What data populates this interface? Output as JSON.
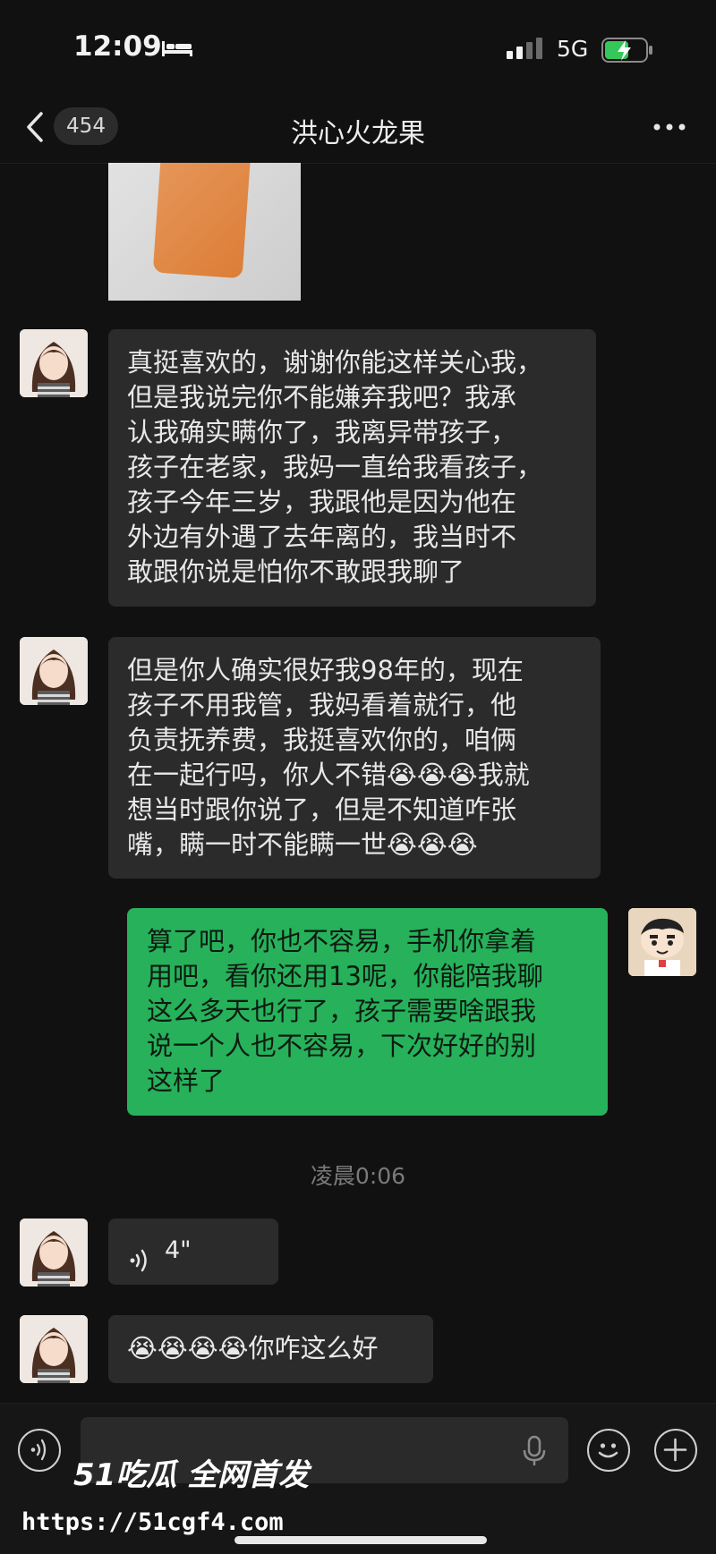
{
  "status_bar": {
    "time": "12:09",
    "network": "5G"
  },
  "header": {
    "unread_count": "454",
    "title": "洪心火龙果"
  },
  "messages": {
    "m1": "真挺喜欢的，谢谢你能这样关心我，\n但是我说完你不能嫌弃我吧？我承\n认我确实瞒你了，我离异带孩子，\n孩子在老家，我妈一直给我看孩子，\n孩子今年三岁，我跟他是因为他在\n外边有外遇了去年离的，我当时不\n敢跟你说是怕你不敢跟我聊了",
    "m2": "但是你人确实很好我98年的，现在\n孩子不用我管，我妈看着就行，他\n负责抚养费，我挺喜欢你的，咱俩\n在一起行吗，你人不错😭😭😭我就\n想当时跟你说了，但是不知道咋张\n嘴，瞒一时不能瞒一世😭😭😭",
    "m3": "算了吧，你也不容易，手机你拿着\n用吧，看你还用13呢，你能陪我聊\n这么多天也行了，孩子需要啥跟我\n说一个人也不容易，下次好好的别\n这样了",
    "timestamp": "凌晨0:06",
    "voice_duration": "4\"",
    "m5": "😭😭😭😭你咋这么好"
  },
  "watermark": {
    "brand": "51吃瓜 全网首发",
    "url": "https://51cgf4.com"
  },
  "colors": {
    "background": "#111111",
    "incoming_bubble": "#2b2b2b",
    "outgoing_bubble": "#26b15a"
  }
}
